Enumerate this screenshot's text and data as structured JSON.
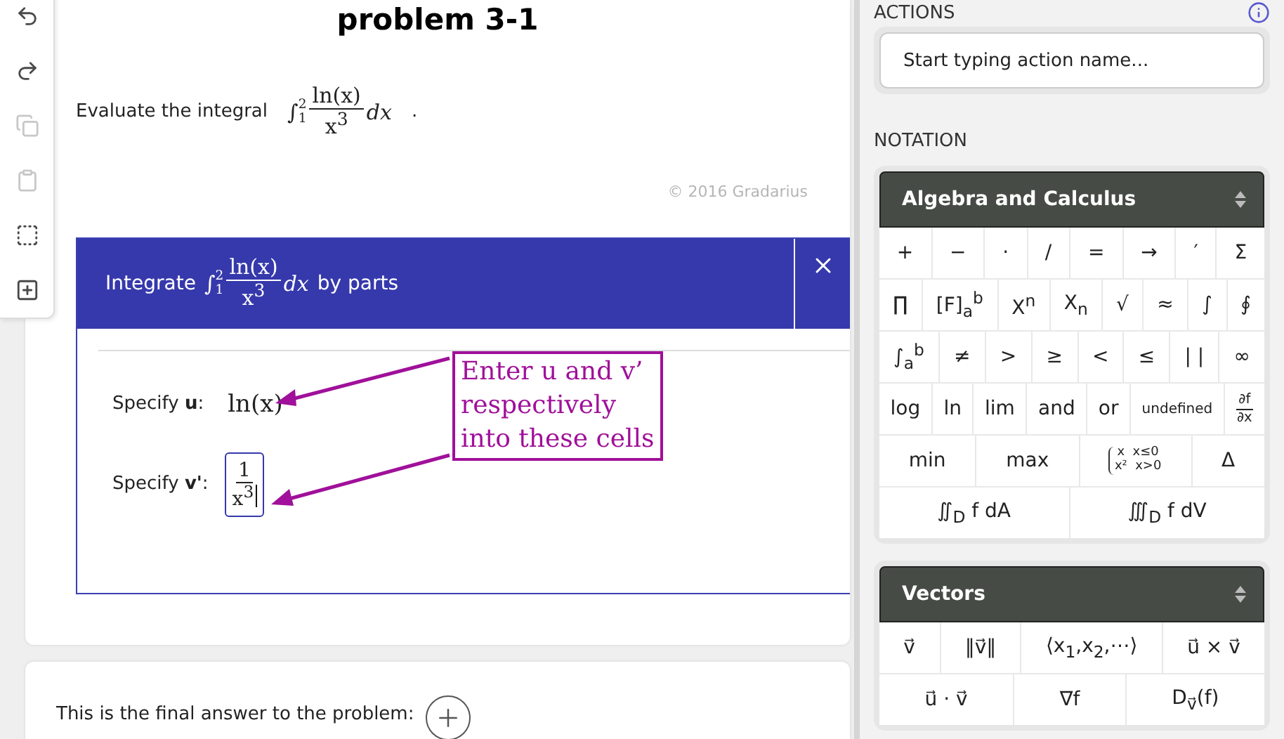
{
  "toolbar": [
    {
      "kind": "undo",
      "disabled": false
    },
    {
      "kind": "redo",
      "disabled": false
    },
    {
      "kind": "copy",
      "disabled": true
    },
    {
      "kind": "paste",
      "disabled": true
    },
    {
      "kind": "select",
      "disabled": false
    },
    {
      "kind": "add",
      "disabled": false
    }
  ],
  "problem": {
    "title": "problem 3-1",
    "prompt": "Evaluate the integral",
    "integral": {
      "sign": "∫",
      "lower": "1",
      "upper": "2",
      "numerator": "ln(x)",
      "denominator": "x$^{3}$",
      "differential": "dx"
    },
    "end": ".",
    "copyright": "© 2016 Gradarius"
  },
  "dialog": {
    "title_before": "Integrate",
    "integral": {
      "sign": "∫",
      "lower": "1",
      "upper": "2",
      "numerator": "ln(x)",
      "denominator": "x$^{3}$",
      "differential": "dx"
    },
    "title_after": "by parts",
    "fields": [
      {
        "label": "Specify **u**:",
        "kind": "math",
        "value": "ln(x)",
        "focused": false
      },
      {
        "label": "Specify **v'**:",
        "kind": "fraction",
        "numerator": "1",
        "denominator": "x$^{3}$",
        "focused": true
      }
    ],
    "annotation": [
      "Enter u and v’",
      "respectively",
      "into these cells"
    ]
  },
  "final_answer": {
    "text": "This is the final answer to the problem:"
  },
  "sidebar": {
    "actions_label": "ACTIONS",
    "action_search": {
      "placeholder": "Start typing action name..."
    },
    "notation_label": "NOTATION",
    "palettes": [
      {
        "title": "Algebra and Calculus",
        "rows": [
          {
            "buttons": [
              {
                "kind": "text",
                "label": "+"
              },
              {
                "kind": "text",
                "label": "−"
              },
              {
                "kind": "text",
                "label": "·"
              },
              {
                "kind": "text",
                "label": "/"
              },
              {
                "kind": "text",
                "label": "="
              },
              {
                "kind": "text",
                "label": "→"
              },
              {
                "kind": "text",
                "label": "′"
              },
              {
                "kind": "text",
                "label": "Σ"
              }
            ]
          },
          {
            "buttons": [
              {
                "kind": "text",
                "label": "∏"
              },
              {
                "kind": "text",
                "label": "[F]$_{a}$$^{b}$"
              },
              {
                "kind": "text",
                "label": "X$^{n}$"
              },
              {
                "kind": "text",
                "label": "X$_{n}$"
              },
              {
                "kind": "text",
                "label": "√"
              },
              {
                "kind": "text",
                "label": "≈"
              },
              {
                "kind": "text",
                "label": "∫"
              },
              {
                "kind": "text",
                "label": "∮"
              }
            ]
          },
          {
            "buttons": [
              {
                "kind": "text",
                "label": "∫$_{a}$$^{b}$"
              },
              {
                "kind": "text",
                "label": "≠"
              },
              {
                "kind": "text",
                "label": ">"
              },
              {
                "kind": "text",
                "label": "≥"
              },
              {
                "kind": "text",
                "label": "<"
              },
              {
                "kind": "text",
                "label": "≤"
              },
              {
                "kind": "text",
                "label": "| |"
              },
              {
                "kind": "text",
                "label": "∞"
              }
            ]
          },
          {
            "buttons": [
              {
                "kind": "text",
                "label": "log"
              },
              {
                "kind": "text",
                "label": "ln"
              },
              {
                "kind": "text",
                "label": "lim"
              },
              {
                "kind": "text",
                "label": "and"
              },
              {
                "kind": "text",
                "label": "or"
              },
              {
                "kind": "small",
                "label": "undefined"
              },
              {
                "kind": "fraction",
                "numerator": "∂f",
                "denominator": "∂x"
              }
            ]
          },
          {
            "buttons": [
              {
                "kind": "text",
                "label": "min"
              },
              {
                "kind": "text",
                "label": "max"
              },
              {
                "kind": "piecewise",
                "lines": [
                  "x  x≤0",
                  "x²  x>0"
                ]
              },
              {
                "kind": "text",
                "label": "Δ"
              }
            ]
          },
          {
            "buttons": [
              {
                "kind": "text",
                "label": "∬$_{D}$ f dA"
              },
              {
                "kind": "text",
                "label": "∭$_{D}$ f dV"
              }
            ]
          }
        ]
      },
      {
        "title": "Vectors",
        "rows": [
          {
            "buttons": [
              {
                "kind": "text",
                "label": "v⃗"
              },
              {
                "kind": "text",
                "label": "‖v⃗‖"
              },
              {
                "kind": "text",
                "label": "⟨x$_{1}$,x$_{2}$,⋯⟩"
              },
              {
                "kind": "text",
                "label": "u⃗ × v⃗"
              }
            ]
          },
          {
            "buttons": [
              {
                "kind": "text",
                "label": "u⃗ · v⃗"
              },
              {
                "kind": "text",
                "label": "∇f"
              },
              {
                "kind": "text",
                "label": "D$_{v⃗}$(f)"
              }
            ]
          }
        ]
      }
    ]
  }
}
